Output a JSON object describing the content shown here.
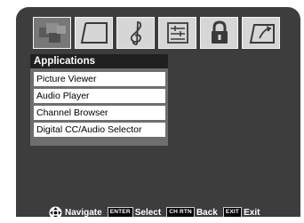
{
  "tabs": [
    {
      "icon": "applications-icon",
      "active": true
    },
    {
      "icon": "picture-icon",
      "active": false
    },
    {
      "icon": "audio-clef-icon",
      "active": false
    },
    {
      "icon": "setup-sliders-icon",
      "active": false
    },
    {
      "icon": "lock-icon",
      "active": false
    },
    {
      "icon": "installation-icon",
      "active": false
    }
  ],
  "menu": {
    "title": "Applications",
    "items": [
      {
        "label": "Picture Viewer"
      },
      {
        "label": "Audio Player"
      },
      {
        "label": "Channel Browser"
      },
      {
        "label": "Digital CC/Audio Selector"
      }
    ]
  },
  "footer": {
    "navigate_label": "Navigate",
    "select_key": "ENTER",
    "select_label": "Select",
    "back_key": "CH RTN",
    "back_label": "Back",
    "exit_key": "EXIT",
    "exit_label": "Exit"
  },
  "colors": {
    "screen_bg": "#3d3d3d",
    "title_bar": "#202020",
    "menu_panel": "#6e6e6e",
    "tab_bg": "#d6d6d6",
    "tab_active_bg": "#787878"
  }
}
